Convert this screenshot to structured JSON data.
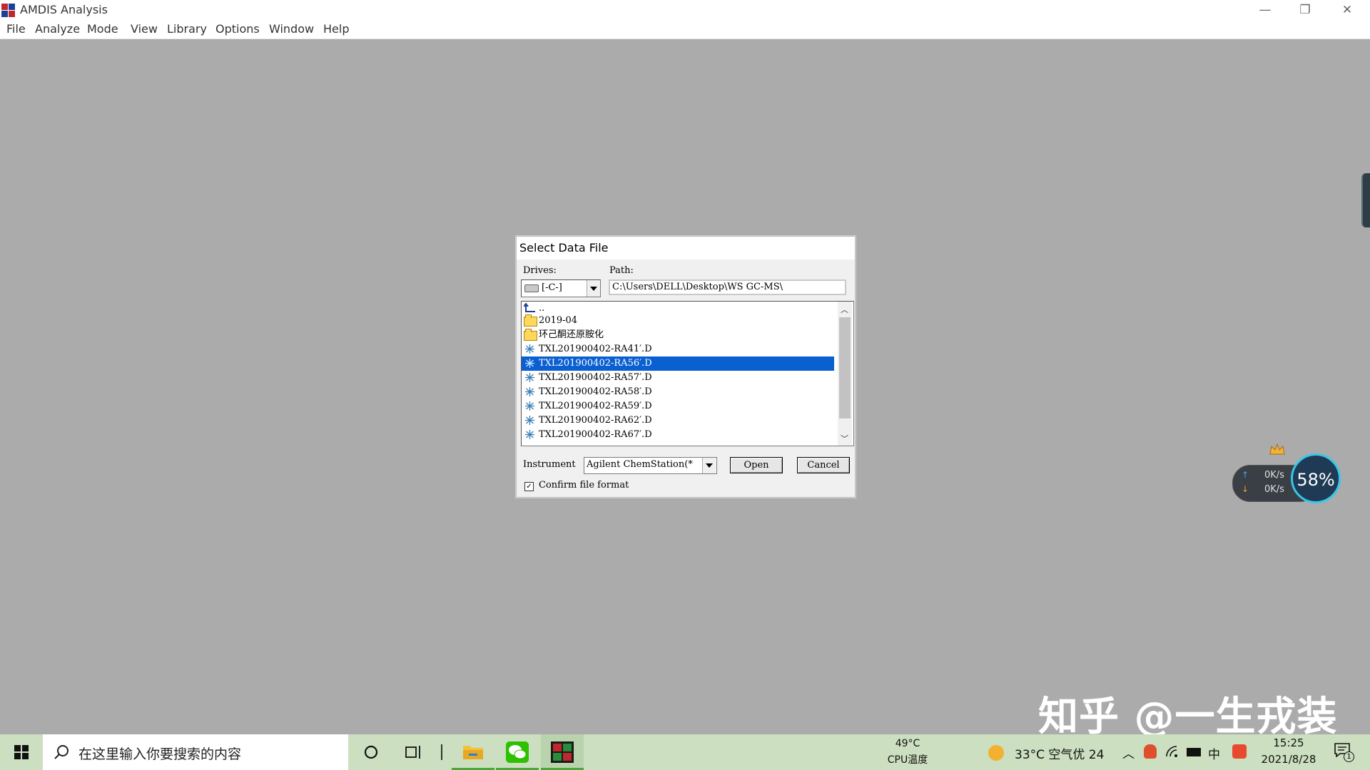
{
  "window": {
    "title": "AMDIS Analysis",
    "controls": [
      "—",
      "❐",
      "✕"
    ]
  },
  "menubar": [
    "File",
    "Analyze",
    "Mode",
    "View",
    "Library",
    "Options",
    "Window",
    "Help"
  ],
  "dialog": {
    "title": "Select Data File",
    "drives_label": "Drives:",
    "drive_value": "[-C-]",
    "path_label": "Path:",
    "path_value": "C:\\Users\\DELL\\Desktop\\WS GC-MS\\",
    "parent_label": "..",
    "items": [
      {
        "name": "2019-04",
        "type": "folder",
        "selected": false
      },
      {
        "name": "环己酮还原胺化",
        "type": "folder",
        "selected": false
      },
      {
        "name": "TXL201900402-RA41′.D",
        "type": "data",
        "selected": false
      },
      {
        "name": "TXL201900402-RA56′.D",
        "type": "data",
        "selected": true
      },
      {
        "name": "TXL201900402-RA57′.D",
        "type": "data",
        "selected": false
      },
      {
        "name": "TXL201900402-RA58′.D",
        "type": "data",
        "selected": false
      },
      {
        "name": "TXL201900402-RA59′.D",
        "type": "data",
        "selected": false
      },
      {
        "name": "TXL201900402-RA62′.D",
        "type": "data",
        "selected": false
      },
      {
        "name": "TXL201900402-RA67′.D",
        "type": "data",
        "selected": false
      }
    ],
    "instrument_label": "Instrument",
    "instrument_value": "Agilent ChemStation(*",
    "open_label": "Open",
    "cancel_label": "Cancel",
    "confirm_label": "Confirm file format",
    "confirm_checked": true
  },
  "net_widget": {
    "up": "0K/s",
    "down": "0K/s",
    "percent": "58%"
  },
  "watermark": "知乎 @一生戎装",
  "taskbar": {
    "search_placeholder": "在这里输入你要搜索的内容",
    "cpu_temp": "49°C",
    "cpu_label": "CPU温度",
    "weather": "33°C 空气优 24",
    "ime": "中",
    "time": "15:25",
    "date": "2021/8/28",
    "notification_count": "1"
  },
  "colors": {
    "selection": "#0a5fd1",
    "workspace": "#ababab",
    "taskbar": "#ccdfc0"
  }
}
